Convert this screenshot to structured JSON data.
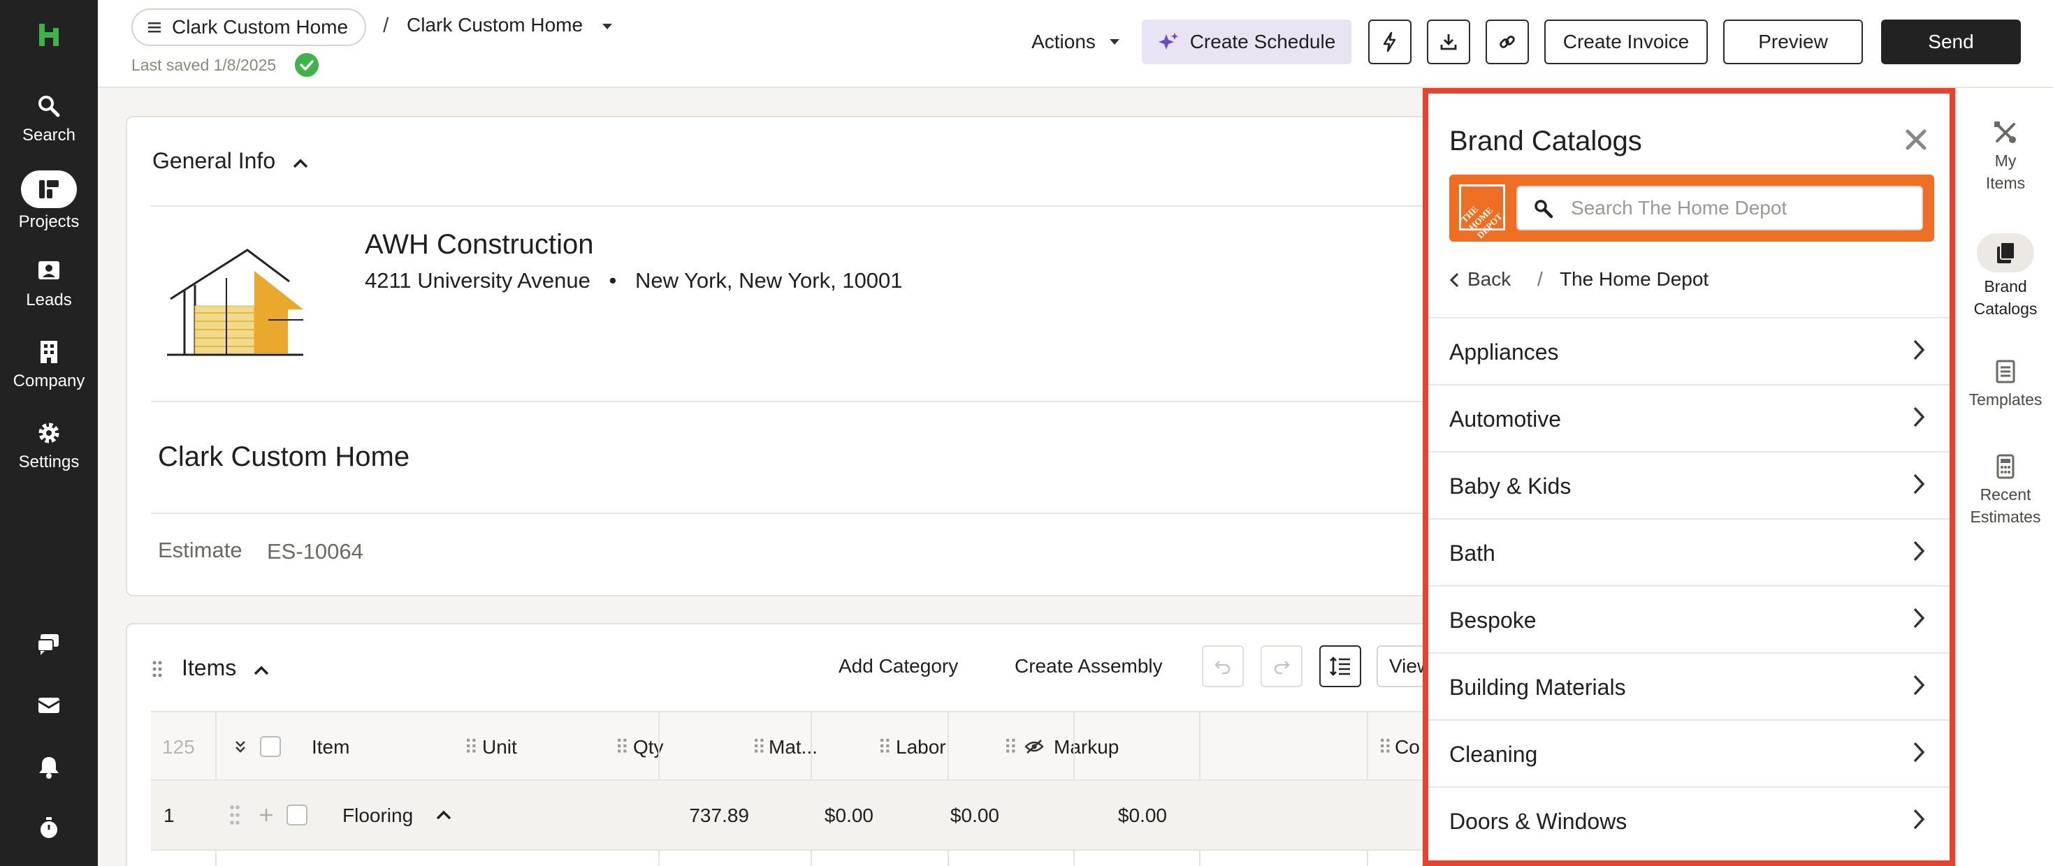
{
  "nav": {
    "items": [
      {
        "label": "Search",
        "icon": "search-icon"
      },
      {
        "label": "Projects",
        "icon": "projects-icon"
      },
      {
        "label": "Leads",
        "icon": "leads-icon"
      },
      {
        "label": "Company",
        "icon": "company-icon"
      },
      {
        "label": "Settings",
        "icon": "settings-icon"
      }
    ],
    "bottom_icons": [
      "chat-icon",
      "inbox-icon",
      "bell-icon",
      "timer-icon"
    ]
  },
  "topbar": {
    "breadcrumb_project": "Clark Custom Home",
    "breadcrumb_separator": "/",
    "breadcrumb_estimate": "Clark Custom Home",
    "last_saved": "Last saved 1/8/2025",
    "actions_label": "Actions",
    "create_schedule_label": "Create Schedule",
    "create_invoice_label": "Create Invoice",
    "preview_label": "Preview",
    "send_label": "Send"
  },
  "general_info": {
    "heading": "General Info",
    "company_name": "AWH Construction",
    "address_street": "4211 University Avenue",
    "address_bullet": "•",
    "address_city": "New York, New York, 10001",
    "project_title": "Clark Custom Home",
    "estimate_label": "Estimate",
    "estimate_number": "ES-10064"
  },
  "items": {
    "heading": "Items",
    "add_category_label": "Add Category",
    "create_assembly_label": "Create Assembly",
    "view_label": "View",
    "columns": {
      "count": "125",
      "item": "Item",
      "unit": "Unit",
      "qty": "Qty",
      "material": "Mat...",
      "labor": "Labor",
      "markup": "Markup",
      "cost": "Co"
    },
    "rows": [
      {
        "index": "1",
        "item": "Flooring",
        "unit": "",
        "qty": "737.89",
        "material": "$0.00",
        "labor": "$0.00",
        "markup": "$0.00"
      }
    ]
  },
  "brand_catalogs": {
    "title": "Brand Catalogs",
    "search_placeholder": "Search The Home Depot",
    "logo_text": "THE HOME DEPOT",
    "back_label": "Back",
    "crumb_separator": "/",
    "current": "The Home Depot",
    "categories": [
      "Appliances",
      "Automotive",
      "Baby & Kids",
      "Bath",
      "Bespoke",
      "Building Materials",
      "Cleaning",
      "Doors & Windows"
    ],
    "accent_color": "#e5432e",
    "brand_color": "#ee6f24"
  },
  "rail": {
    "items": [
      {
        "label_1": "My",
        "label_2": "Items",
        "icon": "my-items-icon"
      },
      {
        "label_1": "Brand",
        "label_2": "Catalogs",
        "icon": "brand-catalogs-icon"
      },
      {
        "label_1": "Templates",
        "label_2": "",
        "icon": "templates-icon"
      },
      {
        "label_1": "Recent",
        "label_2": "Estimates",
        "icon": "recent-estimates-icon"
      }
    ]
  }
}
